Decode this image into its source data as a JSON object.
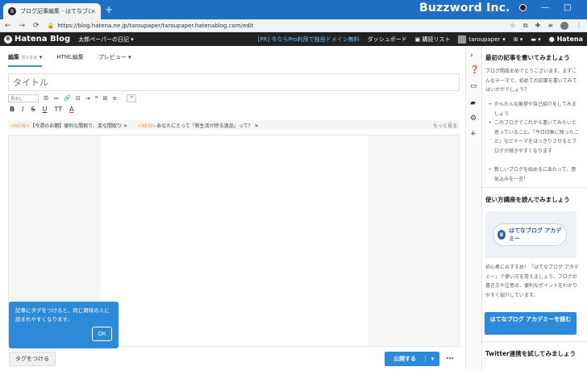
{
  "browser": {
    "tab_title": "ブログ記事編集 - はてなブログ",
    "new_tab_symbol": "+",
    "brand": "Buzzword Inc.",
    "minimize": "—",
    "maximize": "□",
    "close": "✕",
    "url": "https://blog.hatena.ne.jp/taroupaper/taroupaper.hatenablog.com/edit"
  },
  "header": {
    "logo": "Hatena Blog",
    "blog_name": "太郎ペーパーの日記",
    "pro_promo": "[PR] 今ならPro利用で独自ドメイン無料",
    "dashboard": "ダッシュボード",
    "subscriptions": "購読リスト",
    "user": "taroupaper",
    "hatena": "Hatena"
  },
  "editor": {
    "tabs": [
      {
        "label": "編集",
        "sub": "見たまま"
      },
      {
        "label": "HTML編集"
      },
      {
        "label": "プレビュー"
      }
    ],
    "title_placeholder": "タイトル",
    "heading_select": "見出し",
    "news": [
      {
        "badge": "<NEW>",
        "text": "【今週のお題】便利な間取り、変な間取り"
      },
      {
        "badge": "<NEW>",
        "text": "あなたにとって「新生活が捗る逸品」って？"
      }
    ],
    "news_more": "もっと見る",
    "tooltip": "記事にタグをつけると、同じ興味の人に読まれやすくなります。",
    "tooltip_ok": "OK",
    "tag_button": "タグをつける",
    "publish": "公開する"
  },
  "panel": {
    "section1_title": "最初の記事を書いてみましょう",
    "section1_text": "ブログ開設おめでとうございます。まずこんなテーマで、初めての記事を書いてみてはいかがでしょう？",
    "bullets": [
      "かんたんな挨拶や自己紹介をしてみましょう",
      "このブログでこれから書いてみたいと思っていること。「今日印象に残ったこと」などテーマをはっきりさせるとブログが続きやすくなります",
      "新しいブログを始めるにあたって、意気込みを一言！"
    ],
    "section2_title": "使い方講座を読んでみましょう",
    "academy_label": "はてなブログ アカデミー",
    "section2_text": "初心者におすすめ！「はてなブログ アカデミー」で使い方を覚えましょう。ブログの書き方や注意点、便利なポイントをわかりやすく紹介しています。",
    "academy_button": "はてなブログ アカデミーを読む",
    "section3_title": "Twitter連携を試してみましょう"
  }
}
